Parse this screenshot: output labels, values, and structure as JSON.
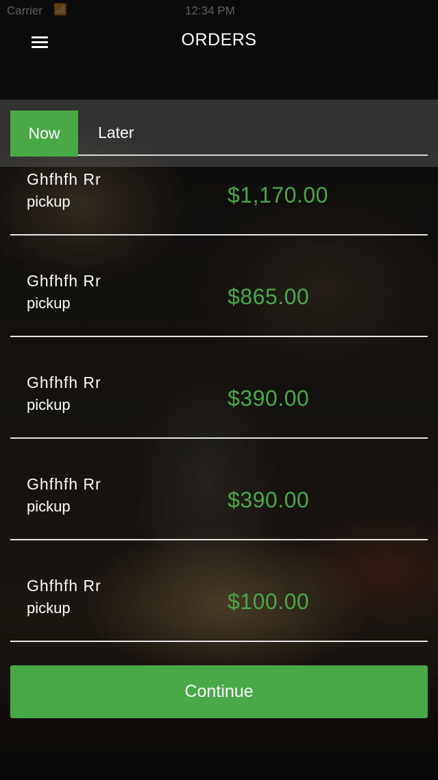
{
  "status_bar": {
    "carrier": "Carrier",
    "time": "12:34 PM"
  },
  "header": {
    "title": "ORDERS",
    "menu_icon": "hamburger-menu-icon"
  },
  "tabs": [
    {
      "label": "Now",
      "selected": true
    },
    {
      "label": "Later",
      "selected": false
    }
  ],
  "orders": [
    {
      "name": "Ghfhfh Rr",
      "type": "pickup",
      "amount": "$1,170.00"
    },
    {
      "name": "Ghfhfh Rr",
      "type": "pickup",
      "amount": "$865.00"
    },
    {
      "name": "Ghfhfh Rr",
      "type": "pickup",
      "amount": "$390.00"
    },
    {
      "name": "Ghfhfh Rr",
      "type": "pickup",
      "amount": "$390.00"
    },
    {
      "name": "Ghfhfh Rr",
      "type": "pickup",
      "amount": "$100.00"
    }
  ],
  "continue_label": "Continue",
  "colors": {
    "accent": "#48a946",
    "divider": "#e6e6e6"
  }
}
